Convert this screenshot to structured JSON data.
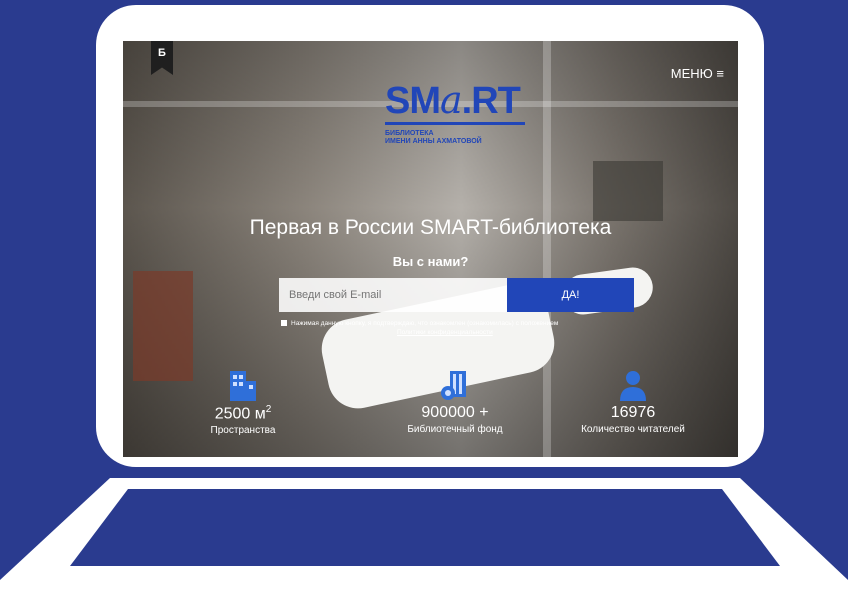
{
  "site": {
    "bookmark_letter": "Б",
    "menu_label": "МЕНЮ ≡",
    "logo": {
      "prefix": "SM",
      "script": "a",
      "suffix": ".RT",
      "line1": "БИБЛИОТЕКА",
      "line2": "ИМЕНИ АННЫ АХМАТОВОЙ"
    }
  },
  "hero": {
    "headline": "Первая в России SMART-библиотека",
    "question": "Вы с нами?",
    "email_placeholder": "Введи свой E-mail",
    "submit_label": "ДА!",
    "consent_text": "Нажимая данную кнопку, я подтверждаю, что ознакомлен (ознакомилась) с положением",
    "consent_link": "Политики конфиденциальности"
  },
  "stats": [
    {
      "value": "2500 м",
      "sup": "2",
      "label": "Пространства",
      "icon": "building-icon"
    },
    {
      "value": "900000 +",
      "label": "Библиотечный фонд",
      "icon": "books-icon"
    },
    {
      "value": "16976",
      "label": "Количество читателей",
      "icon": "person-icon"
    }
  ],
  "colors": {
    "background": "#2a3b8f",
    "accent": "#2146b8",
    "frame": "#ffffff"
  }
}
